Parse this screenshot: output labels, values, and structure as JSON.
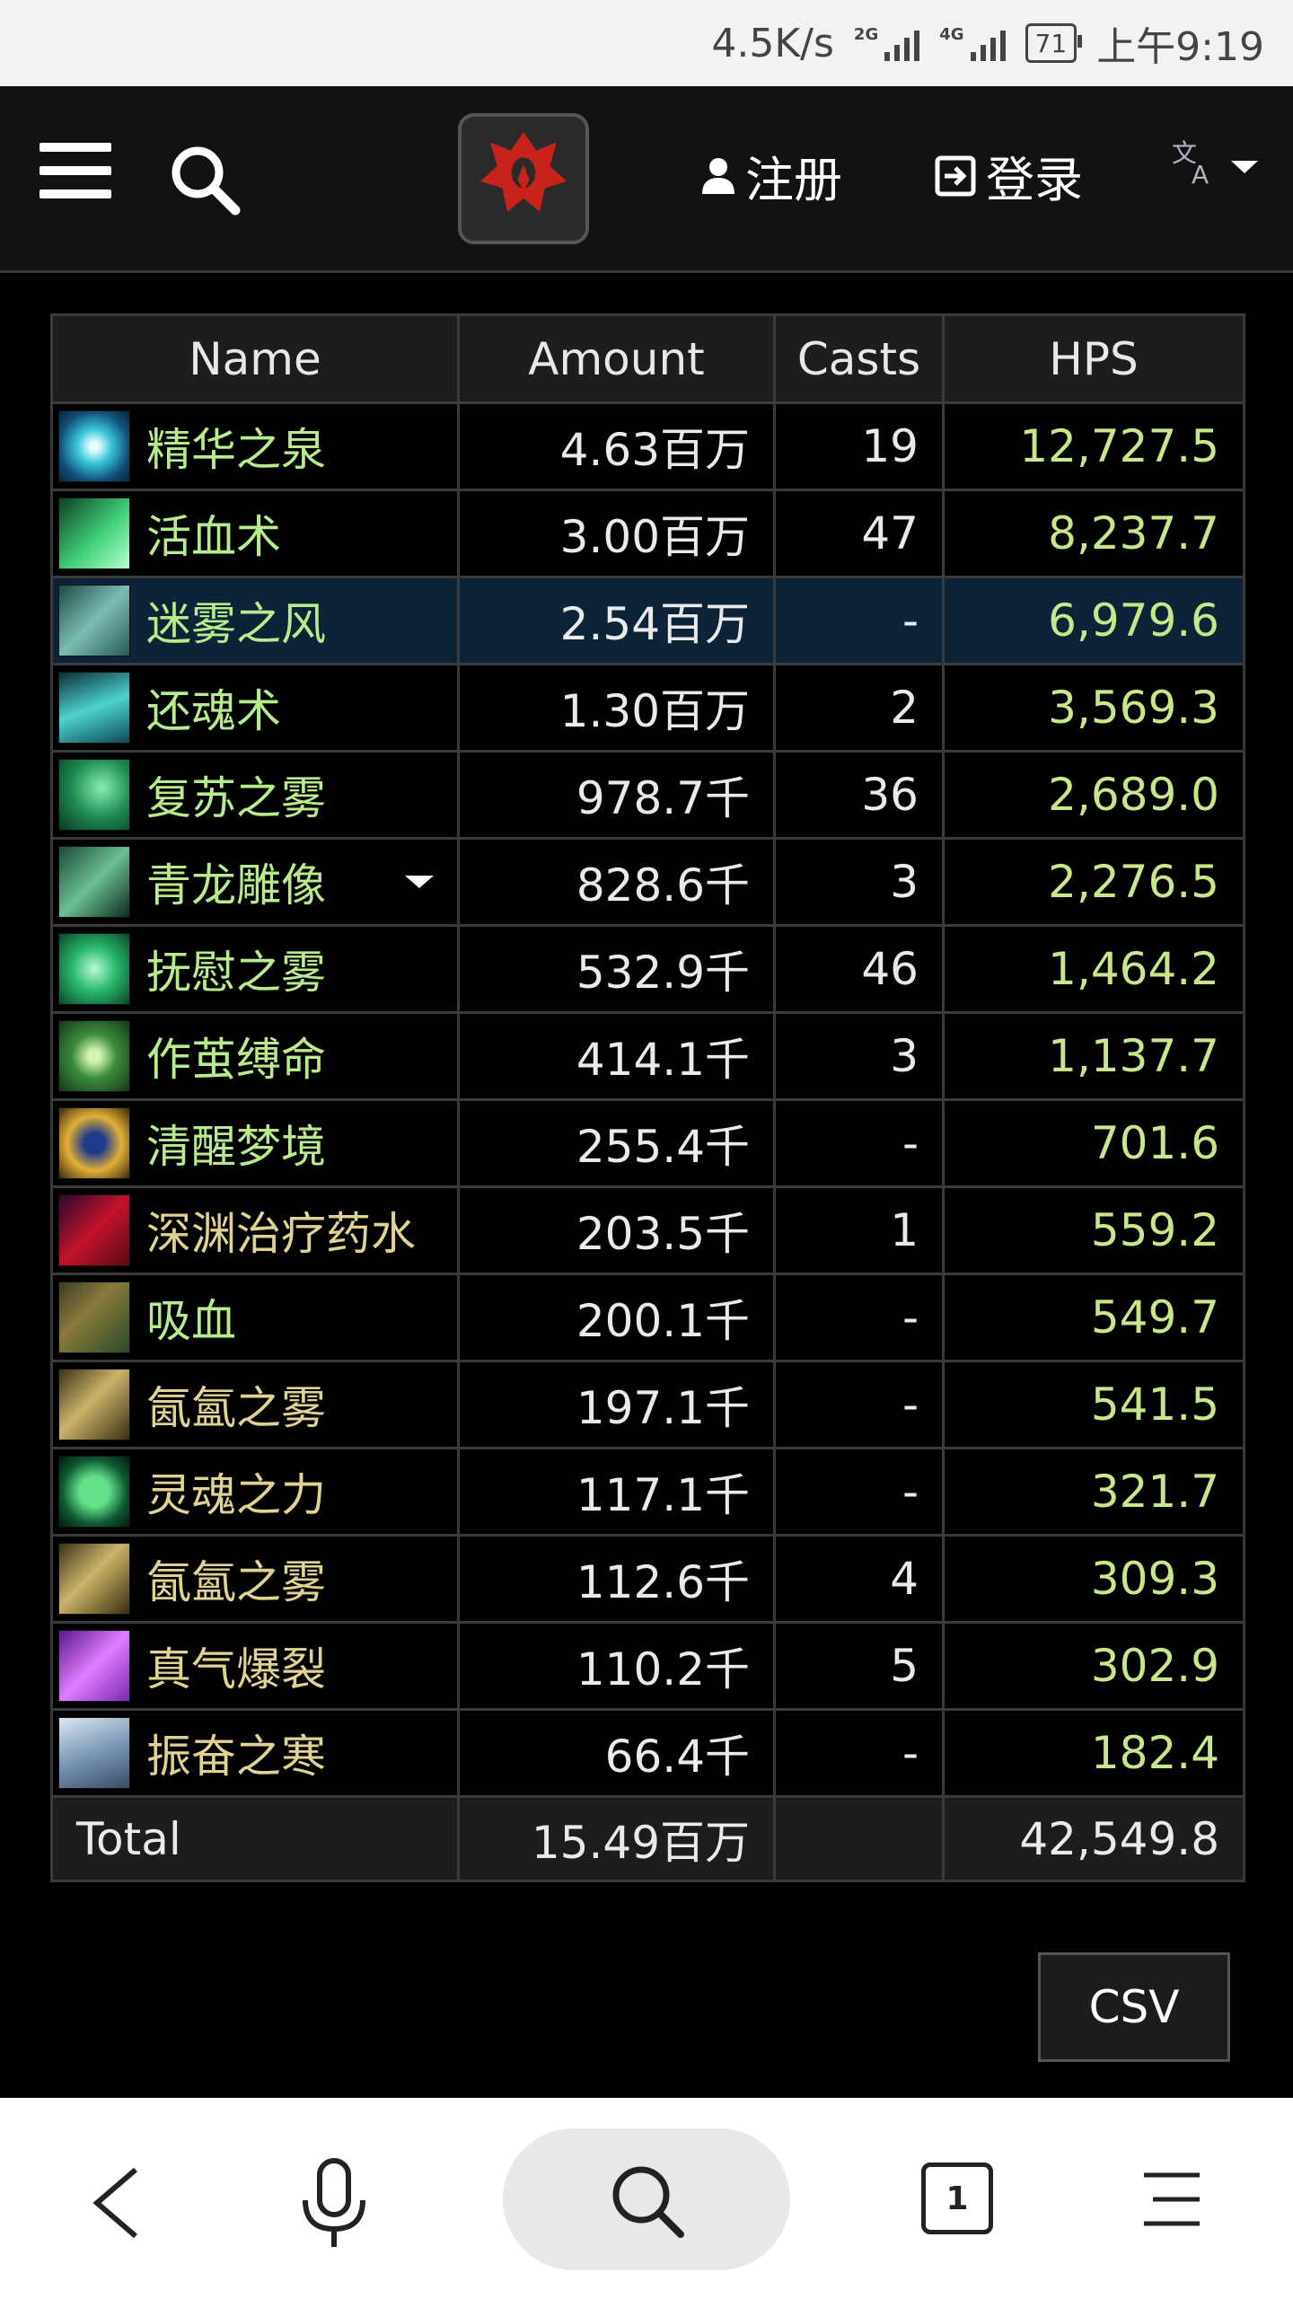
{
  "status_bar": {
    "speed": "4.5K/s",
    "net1": "2G",
    "net2": "4G",
    "battery": "71",
    "time": "上午9:19"
  },
  "header": {
    "menu_icon": "hamburger-menu-icon",
    "search_icon": "search-icon",
    "logo_icon": "horde-logo-icon",
    "register_label": "注册",
    "login_label": "登录",
    "language_icon": "translate-icon"
  },
  "table": {
    "columns": [
      "Name",
      "Amount",
      "Casts",
      "HPS"
    ],
    "rows": [
      {
        "name": "精华之泉",
        "amount": "4.63百万",
        "casts": "19",
        "hps": "12,727.5"
      },
      {
        "name": "活血术",
        "amount": "3.00百万",
        "casts": "47",
        "hps": "8,237.7"
      },
      {
        "name": "迷雾之风",
        "amount": "2.54百万",
        "casts": "-",
        "hps": "6,979.6"
      },
      {
        "name": "还魂术",
        "amount": "1.30百万",
        "casts": "2",
        "hps": "3,569.3"
      },
      {
        "name": "复苏之雾",
        "amount": "978.7千",
        "casts": "36",
        "hps": "2,689.0"
      },
      {
        "name": "青龙雕像",
        "amount": "828.6千",
        "casts": "3",
        "hps": "2,276.5"
      },
      {
        "name": "抚慰之雾",
        "amount": "532.9千",
        "casts": "46",
        "hps": "1,464.2"
      },
      {
        "name": "作茧缚命",
        "amount": "414.1千",
        "casts": "3",
        "hps": "1,137.7"
      },
      {
        "name": "清醒梦境",
        "amount": "255.4千",
        "casts": "-",
        "hps": "701.6"
      },
      {
        "name": "深渊治疗药水",
        "amount": "203.5千",
        "casts": "1",
        "hps": "559.2"
      },
      {
        "name": "吸血",
        "amount": "200.1千",
        "casts": "-",
        "hps": "549.7"
      },
      {
        "name": "氤氳之雾",
        "amount": "197.1千",
        "casts": "-",
        "hps": "541.5"
      },
      {
        "name": "灵魂之力",
        "amount": "117.1千",
        "casts": "-",
        "hps": "321.7"
      },
      {
        "name": "氤氳之雾",
        "amount": "112.6千",
        "casts": "4",
        "hps": "309.3"
      },
      {
        "name": "真气爆裂",
        "amount": "110.2千",
        "casts": "5",
        "hps": "302.9"
      },
      {
        "name": "振奋之寒",
        "amount": "66.4千",
        "casts": "-",
        "hps": "182.4"
      }
    ],
    "total": {
      "label": "Total",
      "amount": "15.49百万",
      "casts": "",
      "hps": "42,549.8"
    }
  },
  "csv_button": "CSV",
  "bottom_nav": {
    "back_icon": "back-arrow-icon",
    "voice_icon": "microphone-icon",
    "search_icon": "search-icon",
    "tabs_count": "1",
    "menu_icon": "menu-icon"
  },
  "colors": {
    "spell_name": "#b8eb8c",
    "hps_value": "#c7e78a",
    "selected_row": "#0d2338",
    "header_bg": "#121212"
  }
}
